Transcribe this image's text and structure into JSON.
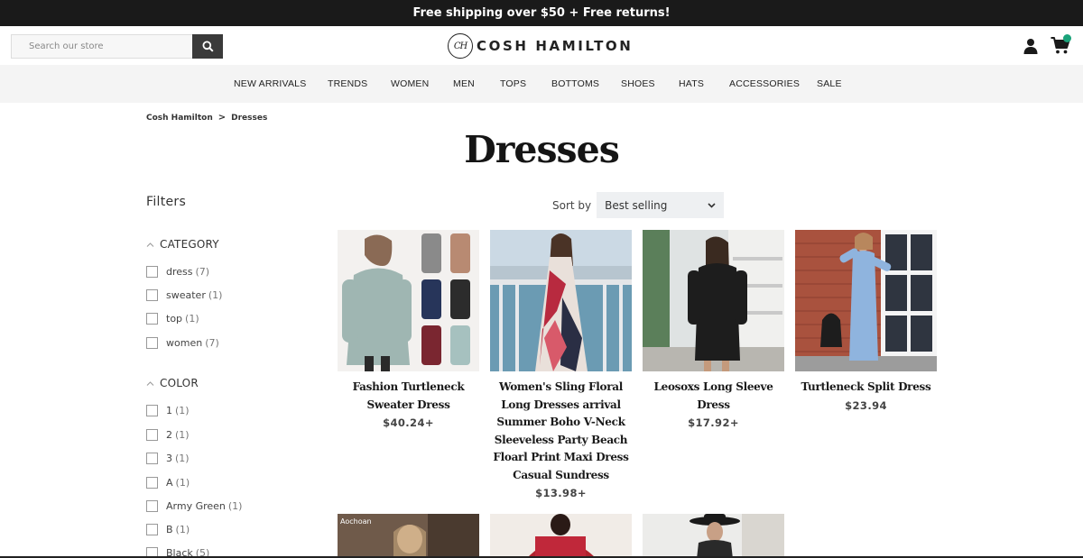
{
  "announcement": "Free shipping over $50 + Free returns!",
  "search": {
    "placeholder": "Search our store"
  },
  "logo": {
    "mark": "CH",
    "text": "COSH HAMILTON"
  },
  "icons": {
    "account": "user-icon",
    "cart": "cart-icon",
    "search": "search-icon"
  },
  "colors": {
    "announcement_bg": "#1a1a1a",
    "nav_bg": "#f4f4f4",
    "cart_badge": "#1aa37a",
    "search_button": "#3a3a3a"
  },
  "nav": [
    "NEW ARRIVALS",
    "TRENDS",
    "WOMEN",
    "MEN",
    "TOPS",
    "BOTTOMS",
    "SHOES",
    "HATS",
    "ACCESSORIES",
    "SALE"
  ],
  "breadcrumb": {
    "home": "Cosh Hamilton",
    "sep": ">",
    "current": "Dresses"
  },
  "page_title": "Dresses",
  "filters": {
    "title": "Filters",
    "category": {
      "label": "CATEGORY",
      "options": [
        {
          "name": "dress",
          "count": "(7)"
        },
        {
          "name": "sweater",
          "count": "(1)"
        },
        {
          "name": "top",
          "count": "(1)"
        },
        {
          "name": "women",
          "count": "(7)"
        }
      ]
    },
    "color": {
      "label": "COLOR",
      "options": [
        {
          "name": "1",
          "count": "(1)"
        },
        {
          "name": "2",
          "count": "(1)"
        },
        {
          "name": "3",
          "count": "(1)"
        },
        {
          "name": "A",
          "count": "(1)"
        },
        {
          "name": "Army Green",
          "count": "(1)"
        },
        {
          "name": "B",
          "count": "(1)"
        },
        {
          "name": "Black",
          "count": "(5)"
        }
      ]
    }
  },
  "sort": {
    "label": "Sort by",
    "value": "Best selling"
  },
  "products": [
    {
      "title": "Fashion Turtleneck Sweater Dress",
      "price": "$40.24+"
    },
    {
      "title": "Women's Sling Floral Long Dresses arrival Summer Boho V-Neck Sleeveless Party Beach Floarl Print Maxi Dress Casual Sundress",
      "price": "$13.98+"
    },
    {
      "title": "Leosoxs Long Sleeve Dress",
      "price": "$17.92+"
    },
    {
      "title": "Turtleneck Split Dress",
      "price": "$23.94"
    }
  ],
  "second_row_labels": [
    "Aochoan"
  ]
}
